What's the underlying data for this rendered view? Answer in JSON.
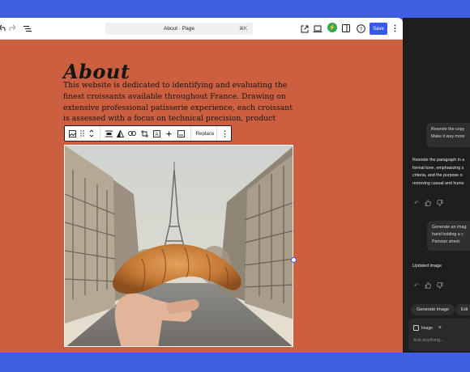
{
  "toolbar": {
    "document_title": "About · Page",
    "shortcut": "⌘K",
    "save_label": "Save"
  },
  "content": {
    "title": "About",
    "paragraph": "This website is dedicated to identifying and evaluating the finest croissants available throughout France. Drawing on extensive professional patisserie experience, each croissant is assessed with a focus on technical precision, product"
  },
  "block_toolbar": {
    "replace_label": "Replace"
  },
  "chat": {
    "user_message_1": [
      "Rewrote the copy",
      "Make it way more"
    ],
    "assistant_reply_1": [
      "Rewrote the paragraph in a",
      "formal tone, emphasizing s",
      "criteria, and the purpose o",
      "removing casual and humo"
    ],
    "user_message_2": [
      "Generate an imag",
      "hand holding a c",
      "Parisian street."
    ],
    "assistant_reply_2": "Updated image",
    "chips": [
      "Generate image",
      "Edi"
    ],
    "attachment_label": "Image",
    "input_placeholder": "Ask anything..."
  },
  "colors": {
    "canvas_background": "#cb5f3f",
    "accent": "#3858e9",
    "sidebar_background": "#1e1e1e",
    "outer_background": "#3d5fe0"
  }
}
